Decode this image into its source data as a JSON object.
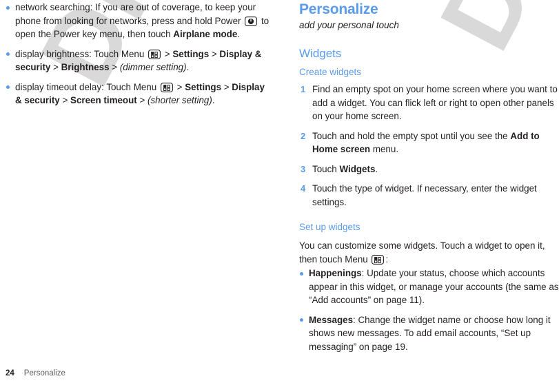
{
  "document": {
    "page_number": "24",
    "footer_label": "Personalize",
    "watermark_text": "DRAFT",
    "accent_color": "#5a9bea",
    "text_color": "#231f20",
    "watermark_color": "#d9d9d9"
  },
  "left_column": {
    "bullets": [
      {
        "id": "network-searching",
        "segments": [
          {
            "text": "network searching: If you are out of coverage, to keep your phone from looking for networks, press and hold Power ",
            "style": "normal"
          },
          {
            "text": "power-key-icon",
            "style": "icon"
          },
          {
            "text": " to open the Power key menu, then touch ",
            "style": "normal"
          },
          {
            "text": "Airplane mode",
            "style": "bold"
          },
          {
            "text": ".",
            "style": "normal"
          }
        ]
      },
      {
        "id": "display-brightness",
        "segments": [
          {
            "text": "display brightness: Touch Menu ",
            "style": "normal"
          },
          {
            "text": "menu-key-icon",
            "style": "icon"
          },
          {
            "text": " > ",
            "style": "normal"
          },
          {
            "text": "Settings",
            "style": "bold"
          },
          {
            "text": " > ",
            "style": "normal"
          },
          {
            "text": "Display & security",
            "style": "bold"
          },
          {
            "text": " > ",
            "style": "normal"
          },
          {
            "text": "Brightness",
            "style": "bold"
          },
          {
            "text": " > ",
            "style": "normal"
          },
          {
            "text": "(dimmer setting)",
            "style": "italic"
          },
          {
            "text": ".",
            "style": "normal"
          }
        ]
      },
      {
        "id": "display-timeout-delay",
        "segments": [
          {
            "text": "display timeout delay: Touch Menu ",
            "style": "normal"
          },
          {
            "text": "menu-key-icon",
            "style": "icon"
          },
          {
            "text": " > ",
            "style": "normal"
          },
          {
            "text": "Settings",
            "style": "bold"
          },
          {
            "text": " > ",
            "style": "normal"
          },
          {
            "text": "Display & security",
            "style": "bold"
          },
          {
            "text": " > ",
            "style": "normal"
          },
          {
            "text": "Screen timeout",
            "style": "bold"
          },
          {
            "text": " > ",
            "style": "normal"
          },
          {
            "text": "(shorter setting)",
            "style": "italic"
          },
          {
            "text": ".",
            "style": "normal"
          }
        ]
      }
    ]
  },
  "right_column": {
    "chapter_title": "Personalize",
    "chapter_subtitle": "add your personal touch",
    "section_heading": "Widgets",
    "subsection_create": "Create widgets",
    "steps": [
      {
        "number": "1",
        "segments": [
          {
            "text": "Find an empty spot on your home screen where you want to add a widget. You can flick left or right to open other panels on your home screen.",
            "style": "normal"
          }
        ]
      },
      {
        "number": "2",
        "segments": [
          {
            "text": "Touch and hold the empty spot until you see the ",
            "style": "normal"
          },
          {
            "text": "Add to Home screen",
            "style": "bold"
          },
          {
            "text": " menu.",
            "style": "normal"
          }
        ]
      },
      {
        "number": "3",
        "segments": [
          {
            "text": "Touch ",
            "style": "normal"
          },
          {
            "text": "Widgets",
            "style": "bold"
          },
          {
            "text": ".",
            "style": "normal"
          }
        ]
      },
      {
        "number": "4",
        "segments": [
          {
            "text": "Touch the type of widget. If necessary, enter the widget settings.",
            "style": "normal"
          }
        ]
      }
    ],
    "subsection_setup": "Set up widgets",
    "setup_intro": [
      {
        "text": "You can customize some widgets. Touch a widget to open it, then touch Menu ",
        "style": "normal"
      },
      {
        "text": "menu-key-icon",
        "style": "icon"
      },
      {
        "text": ":",
        "style": "normal"
      }
    ],
    "setup_bullets": [
      {
        "id": "happenings",
        "segments": [
          {
            "text": "Happenings",
            "style": "bold"
          },
          {
            "text": ": Update your status, choose which accounts appear in this widget, or manage your accounts (the same as “Add accounts” on page 11).",
            "style": "normal"
          }
        ]
      },
      {
        "id": "messages",
        "segments": [
          {
            "text": "Messages",
            "style": "bold"
          },
          {
            "text": ": Change the widget name or choose how long it shows new messages. To add email accounts, “Set up messaging” on page 19.",
            "style": "normal"
          }
        ]
      }
    ]
  }
}
